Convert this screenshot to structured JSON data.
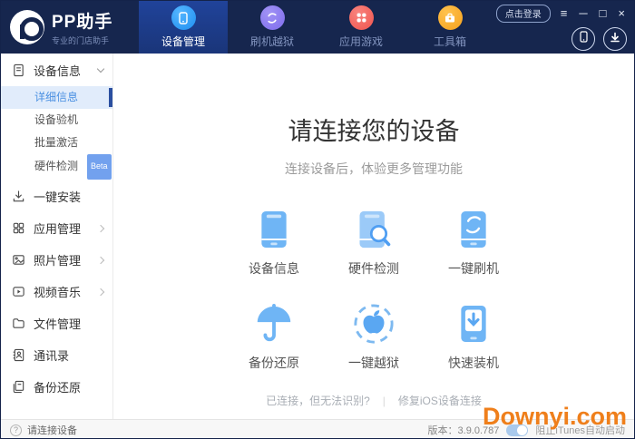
{
  "app": {
    "name": "PP助手",
    "tagline": "专业的门店助手"
  },
  "header": {
    "login_label": "点击登录",
    "tabs": [
      {
        "label": "设备管理",
        "icon": "device-manage-icon",
        "color": "#2f9bf5",
        "active": true
      },
      {
        "label": "刷机越狱",
        "icon": "flash-jailbreak-icon",
        "color": "#8a7cf0",
        "active": false
      },
      {
        "label": "应用游戏",
        "icon": "apps-games-icon",
        "color": "#f4655f",
        "active": false
      },
      {
        "label": "工具箱",
        "icon": "toolbox-icon",
        "color": "#f7a92e",
        "active": false
      }
    ]
  },
  "icons": {
    "window_menu": "≡",
    "window_min": "─",
    "window_max": "□",
    "window_close": "×",
    "help": "?"
  },
  "sidebar": {
    "group": {
      "label": "设备信息",
      "items": [
        {
          "label": "详细信息",
          "active": true
        },
        {
          "label": "设备验机",
          "active": false
        },
        {
          "label": "批量激活",
          "active": false
        },
        {
          "label": "硬件检测",
          "active": false,
          "badge": "Beta"
        }
      ]
    },
    "items": [
      {
        "label": "一键安装",
        "icon": "install-icon",
        "expandable": false
      },
      {
        "label": "应用管理",
        "icon": "apps-grid-icon",
        "expandable": true
      },
      {
        "label": "照片管理",
        "icon": "photo-icon",
        "expandable": true
      },
      {
        "label": "视频音乐",
        "icon": "video-icon",
        "expandable": true
      },
      {
        "label": "文件管理",
        "icon": "folder-icon",
        "expandable": false
      },
      {
        "label": "通讯录",
        "icon": "contacts-icon",
        "expandable": false
      },
      {
        "label": "备份还原",
        "icon": "backup-icon",
        "expandable": false
      }
    ]
  },
  "main": {
    "title": "请连接您的设备",
    "subtitle": "连接设备后，体验更多管理功能",
    "features": [
      {
        "label": "设备信息",
        "icon": "phone-info-icon"
      },
      {
        "label": "硬件检测",
        "icon": "phone-scan-icon"
      },
      {
        "label": "一键刷机",
        "icon": "phone-flash-icon"
      },
      {
        "label": "备份还原",
        "icon": "umbrella-icon"
      },
      {
        "label": "一键越狱",
        "icon": "apple-jailbreak-icon"
      },
      {
        "label": "快速装机",
        "icon": "phone-install-icon"
      }
    ],
    "links": {
      "left": "已连接，但无法识别?",
      "divider": "|",
      "right": "修复iOS设备连接"
    }
  },
  "footer": {
    "status": "请连接设备",
    "version": "版本：3.9.0.787",
    "itunes_label": "阻止iTunes自动启动",
    "itunes_toggle_on": true
  },
  "watermark": "Downyi.com",
  "colors": {
    "header_bg": "#16264e",
    "active_tab_bg": "#1d3c8c",
    "accent_blue": "#4a90e2",
    "feature_icon_blue": "#6fb5f5",
    "watermark_orange": "#ef7f1b"
  }
}
